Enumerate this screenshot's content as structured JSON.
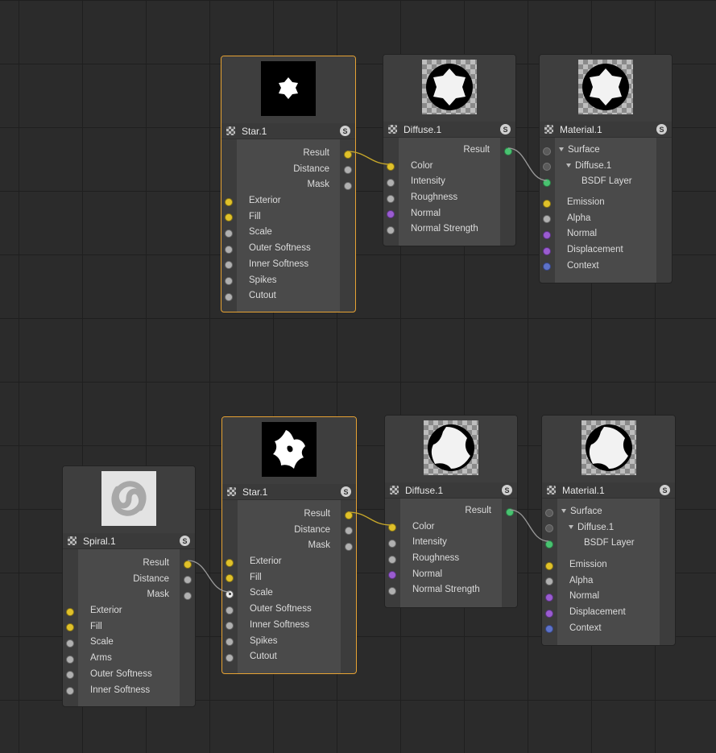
{
  "colors": {
    "canvas": "#2b2b2b",
    "node": "#3c3c3c",
    "selected": "#e6a233",
    "yellow": "#e0c12a",
    "green": "#49c270",
    "purple": "#9a5cd0",
    "blue": "#5d72c8"
  },
  "graph1": {
    "star": {
      "title": "Star.1",
      "s_label": "S",
      "outputs": [
        "Result",
        "Distance",
        "Mask"
      ],
      "inputs": [
        "Exterior",
        "Fill",
        "Scale",
        "Outer Softness",
        "Inner Softness",
        "Spikes",
        "Cutout"
      ]
    },
    "diffuse": {
      "title": "Diffuse.1",
      "s_label": "S",
      "outputs": [
        "Result"
      ],
      "inputs": [
        "Color",
        "Intensity",
        "Roughness",
        "Normal",
        "Normal Strength"
      ]
    },
    "material": {
      "title": "Material.1",
      "s_label": "S",
      "tree": [
        "Surface",
        "Diffuse.1",
        "BSDF Layer"
      ],
      "inputs": [
        "Emission",
        "Alpha",
        "Normal",
        "Displacement",
        "Context"
      ]
    }
  },
  "graph2": {
    "spiral": {
      "title": "Spiral.1",
      "s_label": "S",
      "outputs": [
        "Result",
        "Distance",
        "Mask"
      ],
      "inputs": [
        "Exterior",
        "Fill",
        "Scale",
        "Arms",
        "Outer Softness",
        "Inner Softness"
      ]
    },
    "star": {
      "title": "Star.1",
      "s_label": "S",
      "outputs": [
        "Result",
        "Distance",
        "Mask"
      ],
      "inputs": [
        "Exterior",
        "Fill",
        "Scale",
        "Outer Softness",
        "Inner Softness",
        "Spikes",
        "Cutout"
      ]
    },
    "diffuse": {
      "title": "Diffuse.1",
      "s_label": "S",
      "outputs": [
        "Result"
      ],
      "inputs": [
        "Color",
        "Intensity",
        "Roughness",
        "Normal",
        "Normal Strength"
      ]
    },
    "material": {
      "title": "Material.1",
      "s_label": "S",
      "tree": [
        "Surface",
        "Diffuse.1",
        "BSDF Layer"
      ],
      "inputs": [
        "Emission",
        "Alpha",
        "Normal",
        "Displacement",
        "Context"
      ]
    }
  }
}
